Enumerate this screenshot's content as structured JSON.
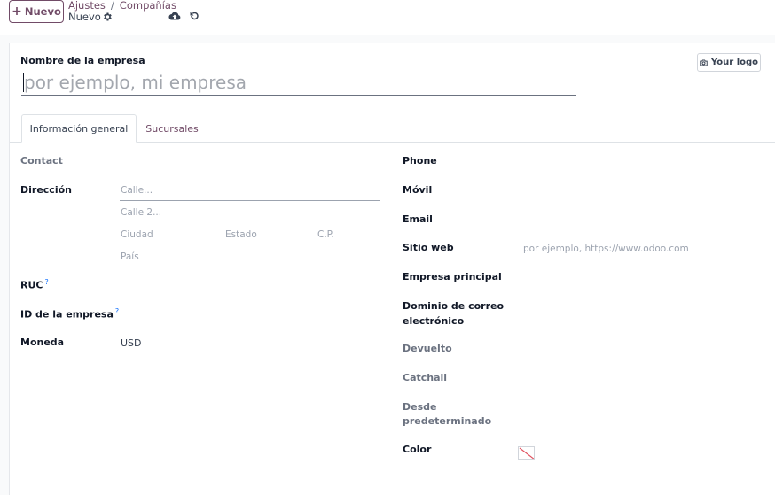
{
  "control_panel": {
    "new_label": "Nuevo",
    "breadcrumb": [
      "Ajustes",
      "Compañías"
    ],
    "breadcrumb_sep": "/",
    "record_name": "Nuevo"
  },
  "form": {
    "company_name_label": "Nombre de la empresa",
    "company_name_placeholder": "por ejemplo, mi empresa",
    "logo_button": "Your logo",
    "tabs": [
      {
        "label": "Información general",
        "active": true
      },
      {
        "label": "Sucursales",
        "active": false
      }
    ],
    "left": {
      "contact_label": "Contact",
      "address_label": "Dirección",
      "street_placeholder": "Calle...",
      "street2_placeholder": "Calle 2...",
      "city_placeholder": "Ciudad",
      "state_placeholder": "Estado",
      "zip_placeholder": "C.P.",
      "country_placeholder": "País",
      "ruc_label": "RUC",
      "company_id_label": "ID de la empresa",
      "help_mark": "?",
      "currency_label": "Moneda",
      "currency_value": "USD"
    },
    "right": {
      "phone_label": "Phone",
      "mobile_label": "Móvil",
      "email_label": "Email",
      "website_label": "Sitio web",
      "website_placeholder": "por ejemplo, https://www.odoo.com",
      "parent_label": "Empresa principal",
      "email_domain_label_1": "Dominio de correo",
      "email_domain_label_2": "electrónico",
      "bounce_label": "Devuelto",
      "catchall_label": "Catchall",
      "default_from_label_1": "Desde",
      "default_from_label_2": "predeterminado",
      "color_label": "Color"
    }
  },
  "colors": {
    "brand": "#714b67",
    "link": "#714b67",
    "help": "#0d6efd",
    "no_color_slash": "#e05260"
  }
}
